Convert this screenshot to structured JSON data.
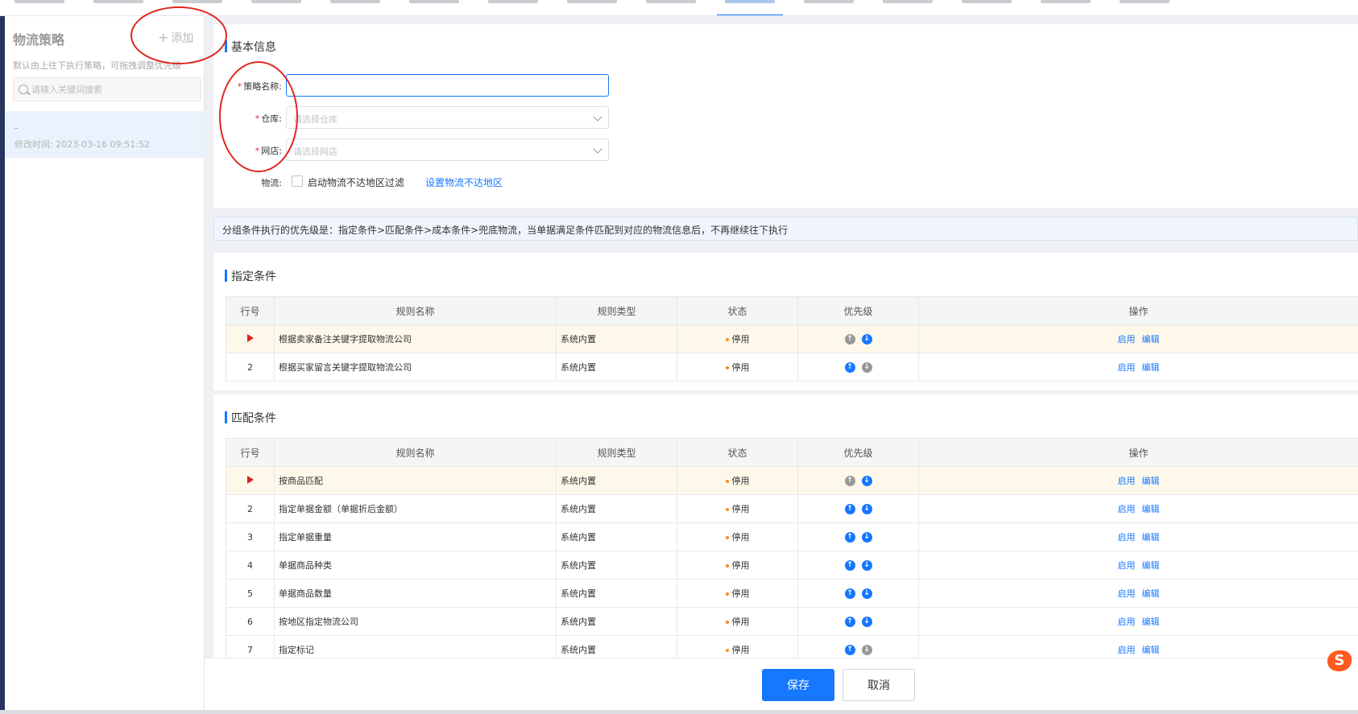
{
  "sidebar": {
    "title": "物流策略",
    "add_label": "添加",
    "hint": "默认由上往下执行策略，可拖拽调整优先级",
    "search_placeholder": "请输入关键词搜索",
    "items": [
      {
        "name": "-",
        "modified": "修改时间: 2023-03-16 09:51:52"
      }
    ]
  },
  "basic_info": {
    "title": "基本信息",
    "strategy_name_label": "策略名称:",
    "strategy_name_value": "",
    "warehouse_label": "仓库:",
    "warehouse_placeholder": "请选择仓库",
    "shop_label": "网店:",
    "shop_placeholder": "请选择网店",
    "logistics_label": "物流:",
    "logistics_checkbox_label": "启动物流不达地区过滤",
    "logistics_link": "设置物流不达地区"
  },
  "notice": "分组条件执行的优先级是：指定条件>匹配条件>成本条件>兜底物流，当单据满足条件匹配到对应的物流信息后，不再继续往下执行",
  "table_headers": {
    "no": "行号",
    "name": "规则名称",
    "type": "规则类型",
    "status": "状态",
    "priority": "优先级",
    "ops": "操作"
  },
  "specified": {
    "title": "指定条件",
    "rows": [
      {
        "no": "",
        "name": "根据卖家备注关键字提取物流公司",
        "type": "系统内置",
        "status": "停用",
        "op1": "启用",
        "op2": "编辑"
      },
      {
        "no": "2",
        "name": "根据买家留言关键字提取物流公司",
        "type": "系统内置",
        "status": "停用",
        "op1": "启用",
        "op2": "编辑"
      }
    ]
  },
  "matching": {
    "title": "匹配条件",
    "rows": [
      {
        "no": "",
        "name": "按商品匹配",
        "type": "系统内置",
        "status": "停用",
        "op1": "启用",
        "op2": "编辑"
      },
      {
        "no": "2",
        "name": "指定单据金额（单据折后金额）",
        "type": "系统内置",
        "status": "停用",
        "op1": "启用",
        "op2": "编辑"
      },
      {
        "no": "3",
        "name": "指定单据重量",
        "type": "系统内置",
        "status": "停用",
        "op1": "启用",
        "op2": "编辑"
      },
      {
        "no": "4",
        "name": "单据商品种类",
        "type": "系统内置",
        "status": "停用",
        "op1": "启用",
        "op2": "编辑"
      },
      {
        "no": "5",
        "name": "单据商品数量",
        "type": "系统内置",
        "status": "停用",
        "op1": "启用",
        "op2": "编辑"
      },
      {
        "no": "6",
        "name": "按地区指定物流公司",
        "type": "系统内置",
        "status": "停用",
        "op1": "启用",
        "op2": "编辑"
      },
      {
        "no": "7",
        "name": "指定标记",
        "type": "系统内置",
        "status": "停用",
        "op1": "启用",
        "op2": "编辑"
      }
    ]
  },
  "footer": {
    "save_label": "保存",
    "cancel_label": "取消"
  },
  "colors": {
    "accent": "#1677ff",
    "warning": "#fa8c16",
    "required": "#f5222d",
    "annotation": "#e0261f"
  }
}
